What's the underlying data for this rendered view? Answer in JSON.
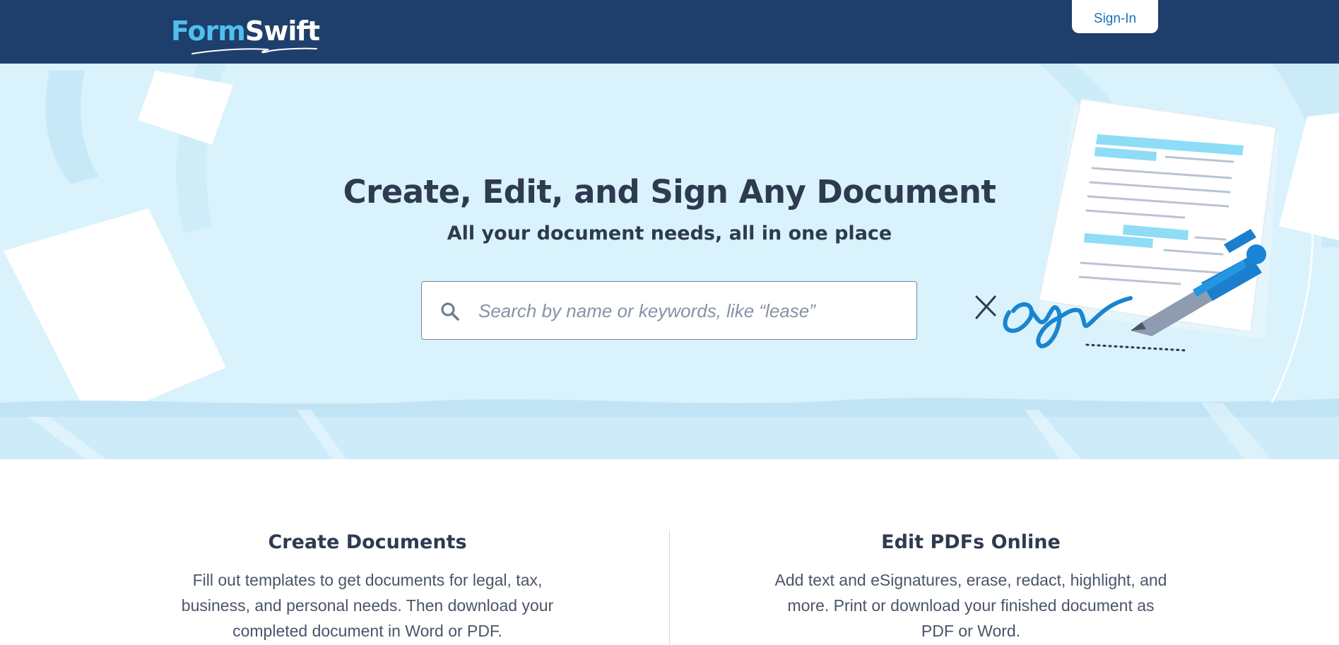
{
  "header": {
    "logo_part1": "Form",
    "logo_part2": "Swift",
    "signin_label": "Sign-In"
  },
  "hero": {
    "title": "Create, Edit, and Sign Any Document",
    "subtitle": "All your document needs, all in one place",
    "search": {
      "placeholder": "Search by name or keywords, like “lease”",
      "value": ""
    }
  },
  "features": [
    {
      "title": "Create Documents",
      "description": "Fill out templates to get documents for legal, tax, business, and personal needs. Then download your completed document in Word or PDF."
    },
    {
      "title": "Edit PDFs Online",
      "description": "Add text and eSignatures, erase, redact, highlight, and more. Print or download your finished document as PDF or Word."
    }
  ],
  "colors": {
    "header_bg": "#1e3f6b",
    "hero_bg": "#d9f2fc",
    "accent_blue": "#1a72b8",
    "logo_light_blue": "#4fc0ee",
    "text_dark": "#2e3a4f"
  },
  "icons": {
    "search": "search-icon",
    "pen": "pen-icon"
  }
}
